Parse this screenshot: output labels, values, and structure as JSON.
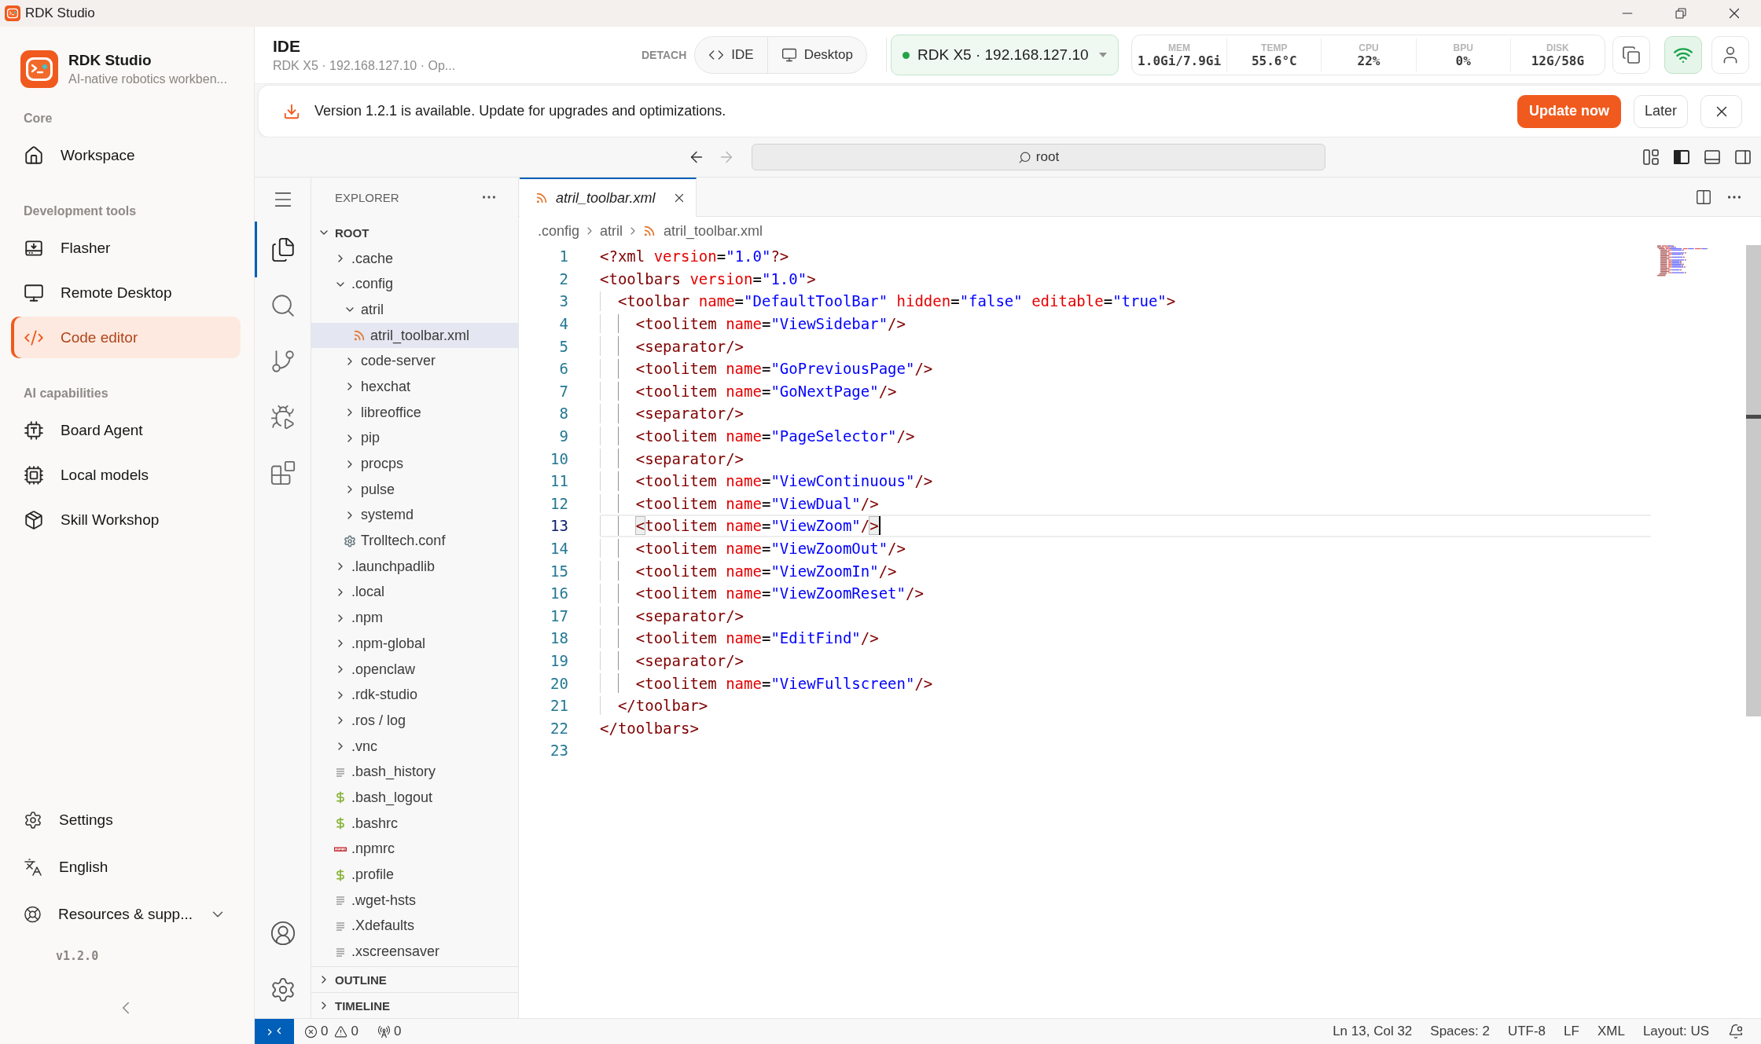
{
  "window": {
    "title": "RDK Studio"
  },
  "sidebar": {
    "app_name": "RDK Studio",
    "tagline": "AI-native robotics workben...",
    "sections": [
      {
        "heading": "Core",
        "items": [
          {
            "label": "Workspace",
            "selected": false
          }
        ]
      },
      {
        "heading": "Development tools",
        "items": [
          {
            "label": "Flasher",
            "selected": false
          },
          {
            "label": "Remote Desktop",
            "selected": false
          },
          {
            "label": "Code editor",
            "selected": true
          }
        ]
      },
      {
        "heading": "AI capabilities",
        "items": [
          {
            "label": "Board Agent",
            "selected": false
          },
          {
            "label": "Local models",
            "selected": false
          },
          {
            "label": "Skill Workshop",
            "selected": false
          }
        ]
      }
    ],
    "footer": [
      {
        "label": "Settings"
      },
      {
        "label": "English"
      }
    ],
    "resources": {
      "label": "Resources & supp...",
      "expanded": false
    },
    "version": "v1.2.0"
  },
  "header": {
    "title": "IDE",
    "subtitle": "RDK X5 · 192.168.127.10 · Op...",
    "detach_label": "DETACH",
    "detach_buttons": [
      {
        "label": "IDE"
      },
      {
        "label": "Desktop"
      }
    ],
    "device": {
      "label": "RDK X5 · 192.168.127.10",
      "online": true
    },
    "stats": [
      {
        "label": "MEM",
        "value": "1.0Gi/7.9Gi"
      },
      {
        "label": "TEMP",
        "value": "55.6°C"
      },
      {
        "label": "CPU",
        "value": "22%"
      },
      {
        "label": "BPU",
        "value": "0%"
      },
      {
        "label": "DISK",
        "value": "12G/58G"
      }
    ],
    "wifi_connected": true
  },
  "update_banner": {
    "message": "Version 1.2.1 is available. Update for upgrades and optimizations.",
    "buttons": [
      {
        "label": "Update now",
        "kind": "primary"
      },
      {
        "label": "Later",
        "kind": "secondary"
      }
    ]
  },
  "nav_bar": {
    "back": {
      "disabled": false
    },
    "forward": {
      "disabled": true
    },
    "address": "root"
  },
  "activity_bar": {
    "items": [
      {
        "selected": true
      },
      {
        "selected": false
      },
      {
        "selected": false
      },
      {
        "selected": false
      },
      {
        "selected": false
      }
    ]
  },
  "explorer": {
    "title": "EXPLORER",
    "tree": [
      {
        "name": "ROOT",
        "kind": "root",
        "expanded": true,
        "selected": false,
        "children": [
          {
            "name": ".cache",
            "kind": "folder",
            "expanded": false,
            "selected": false
          },
          {
            "name": ".config",
            "kind": "folder",
            "expanded": true,
            "selected": false,
            "children": [
              {
                "name": "atril",
                "kind": "folder",
                "expanded": true,
                "selected": false,
                "children": [
                  {
                    "name": "atril_toolbar.xml",
                    "kind": "xml",
                    "selected": true
                  }
                ]
              },
              {
                "name": "code-server",
                "kind": "folder",
                "expanded": false,
                "selected": false
              },
              {
                "name": "hexchat",
                "kind": "folder",
                "expanded": false,
                "selected": false
              },
              {
                "name": "libreoffice",
                "kind": "folder",
                "expanded": false,
                "selected": false
              },
              {
                "name": "pip",
                "kind": "folder",
                "expanded": false,
                "selected": false
              },
              {
                "name": "procps",
                "kind": "folder",
                "expanded": false,
                "selected": false
              },
              {
                "name": "pulse",
                "kind": "folder",
                "expanded": false,
                "selected": false
              },
              {
                "name": "systemd",
                "kind": "folder",
                "expanded": false,
                "selected": false
              },
              {
                "name": "Trolltech.conf",
                "kind": "config",
                "selected": false
              }
            ]
          },
          {
            "name": ".launchpadlib",
            "kind": "folder",
            "expanded": false,
            "selected": false
          },
          {
            "name": ".local",
            "kind": "folder",
            "expanded": false,
            "selected": false
          },
          {
            "name": ".npm",
            "kind": "folder",
            "expanded": false,
            "selected": false
          },
          {
            "name": ".npm-global",
            "kind": "folder",
            "expanded": false,
            "selected": false
          },
          {
            "name": ".openclaw",
            "kind": "folder",
            "expanded": false,
            "selected": false
          },
          {
            "name": ".rdk-studio",
            "kind": "folder",
            "expanded": false,
            "selected": false
          },
          {
            "name": ".ros / log",
            "kind": "folder",
            "expanded": false,
            "selected": false
          },
          {
            "name": ".vnc",
            "kind": "folder",
            "expanded": false,
            "selected": false
          },
          {
            "name": ".bash_history",
            "kind": "text",
            "selected": false
          },
          {
            "name": ".bash_logout",
            "kind": "shell",
            "selected": false
          },
          {
            "name": ".bashrc",
            "kind": "shell",
            "selected": false
          },
          {
            "name": ".npmrc",
            "kind": "npm",
            "selected": false
          },
          {
            "name": ".profile",
            "kind": "shell",
            "selected": false
          },
          {
            "name": ".wget-hsts",
            "kind": "text",
            "selected": false
          },
          {
            "name": ".Xdefaults",
            "kind": "text",
            "selected": false
          },
          {
            "name": ".xscreensaver",
            "kind": "text",
            "selected": false
          }
        ]
      }
    ],
    "sections": [
      {
        "title": "OUTLINE",
        "expanded": false
      },
      {
        "title": "TIMELINE",
        "expanded": false
      }
    ]
  },
  "editor": {
    "tabs": [
      {
        "label": "atril_toolbar.xml",
        "kind": "xml",
        "selected": true,
        "preview": true
      }
    ],
    "breadcrumbs": [
      {
        "label": ".config",
        "kind": "folder"
      },
      {
        "label": "atril",
        "kind": "folder"
      },
      {
        "label": "atril_toolbar.xml",
        "kind": "xml"
      }
    ],
    "lines": [
      {
        "number": "1",
        "text": "<?xml version=\"1.0\"?>",
        "current": false
      },
      {
        "number": "2",
        "text": "<toolbars version=\"1.0\">",
        "current": false
      },
      {
        "number": "3",
        "text": "  <toolbar name=\"DefaultToolBar\" hidden=\"false\" editable=\"true\">",
        "current": false
      },
      {
        "number": "4",
        "text": "    <toolitem name=\"ViewSidebar\"/>",
        "current": false
      },
      {
        "number": "5",
        "text": "    <separator/>",
        "current": false
      },
      {
        "number": "6",
        "text": "    <toolitem name=\"GoPreviousPage\"/>",
        "current": false
      },
      {
        "number": "7",
        "text": "    <toolitem name=\"GoNextPage\"/>",
        "current": false
      },
      {
        "number": "8",
        "text": "    <separator/>",
        "current": false
      },
      {
        "number": "9",
        "text": "    <toolitem name=\"PageSelector\"/>",
        "current": false
      },
      {
        "number": "10",
        "text": "    <separator/>",
        "current": false
      },
      {
        "number": "11",
        "text": "    <toolitem name=\"ViewContinuous\"/>",
        "current": false
      },
      {
        "number": "12",
        "text": "    <toolitem name=\"ViewDual\"/>",
        "current": false
      },
      {
        "number": "13",
        "text": "    <toolitem name=\"ViewZoom\"/>",
        "current": true
      },
      {
        "number": "14",
        "text": "    <toolitem name=\"ViewZoomOut\"/>",
        "current": false
      },
      {
        "number": "15",
        "text": "    <toolitem name=\"ViewZoomIn\"/>",
        "current": false
      },
      {
        "number": "16",
        "text": "    <toolitem name=\"ViewZoomReset\"/>",
        "current": false
      },
      {
        "number": "17",
        "text": "    <separator/>",
        "current": false
      },
      {
        "number": "18",
        "text": "    <toolitem name=\"EditFind\"/>",
        "current": false
      },
      {
        "number": "19",
        "text": "    <separator/>",
        "current": false
      },
      {
        "number": "20",
        "text": "    <toolitem name=\"ViewFullscreen\"/>",
        "current": false
      },
      {
        "number": "21",
        "text": "  </toolbar>",
        "current": false
      },
      {
        "number": "22",
        "text": "</toolbars>",
        "current": false
      },
      {
        "number": "23",
        "current": false
      }
    ]
  },
  "status_bar": {
    "errors": "0",
    "warnings": "0",
    "ports": "0",
    "items": [
      "Ln 13, Col 32",
      "Spaces: 2",
      "UTF-8",
      "LF",
      "XML",
      "Layout: US"
    ],
    "unread_notifications": true
  }
}
